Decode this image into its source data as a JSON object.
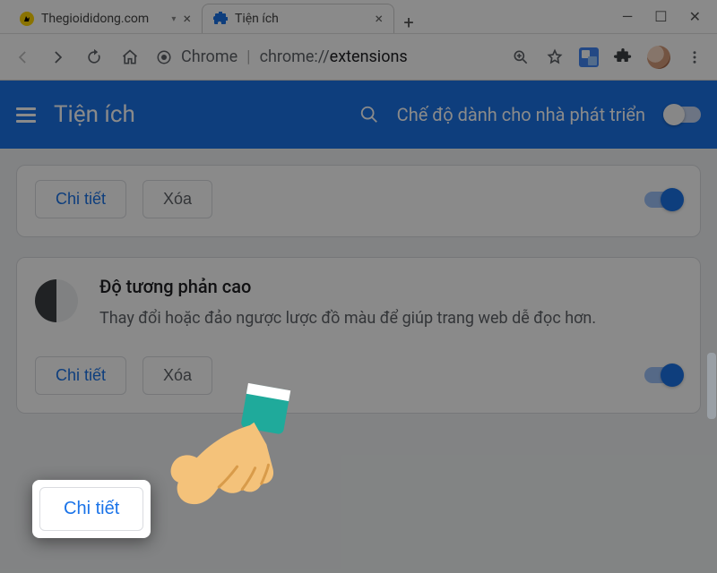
{
  "window": {
    "tabs": [
      {
        "title": "Thegioididong.com",
        "active": false
      },
      {
        "title": "Tiện ích",
        "active": true
      }
    ]
  },
  "address": {
    "prefix": "Chrome",
    "url_dim": "chrome://",
    "url_bold": "extensions"
  },
  "ext_header": {
    "title": "Tiện ích",
    "dev_label": "Chế độ dành cho nhà phát triển"
  },
  "card1": {
    "details": "Chi tiết",
    "remove": "Xóa"
  },
  "card2": {
    "name": "Độ tương phản cao",
    "desc": "Thay đổi hoặc đảo ngược lược đồ màu để giúp trang web dễ đọc hơn.",
    "details": "Chi tiết",
    "remove": "Xóa"
  },
  "highlight": {
    "label": "Chi tiết"
  }
}
